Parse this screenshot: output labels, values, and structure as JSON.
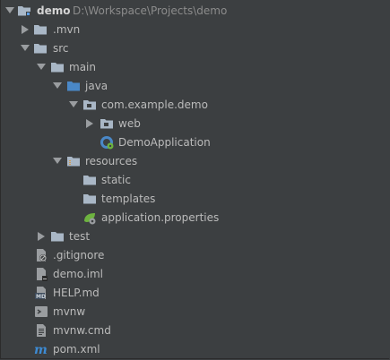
{
  "project": {
    "name": "demo",
    "path": "D:\\Workspace\\Projects\\demo"
  },
  "nodes": [
    {
      "label": "demo",
      "icon": "module-folder-icon",
      "state": "expanded"
    },
    {
      "label": ".mvn",
      "icon": "folder-icon",
      "state": "collapsed"
    },
    {
      "label": "src",
      "icon": "folder-icon",
      "state": "expanded"
    },
    {
      "label": "main",
      "icon": "folder-icon",
      "state": "expanded"
    },
    {
      "label": "java",
      "icon": "source-root-folder-icon",
      "state": "expanded"
    },
    {
      "label": "com.example.demo",
      "icon": "package-icon",
      "state": "expanded"
    },
    {
      "label": "web",
      "icon": "package-icon",
      "state": "collapsed"
    },
    {
      "label": "DemoApplication",
      "icon": "spring-boot-class-icon",
      "state": "leaf"
    },
    {
      "label": "resources",
      "icon": "resources-root-folder-icon",
      "state": "expanded"
    },
    {
      "label": "static",
      "icon": "folder-icon",
      "state": "leaf"
    },
    {
      "label": "templates",
      "icon": "folder-icon",
      "state": "leaf"
    },
    {
      "label": "application.properties",
      "icon": "spring-properties-icon",
      "state": "leaf"
    },
    {
      "label": "test",
      "icon": "folder-icon",
      "state": "collapsed"
    },
    {
      "label": ".gitignore",
      "icon": "gitignore-file-icon",
      "state": "leaf"
    },
    {
      "label": "demo.iml",
      "icon": "iml-file-icon",
      "state": "leaf"
    },
    {
      "label": "HELP.md",
      "icon": "markdown-file-icon",
      "state": "leaf"
    },
    {
      "label": "mvnw",
      "icon": "shell-script-icon",
      "state": "leaf"
    },
    {
      "label": "mvnw.cmd",
      "icon": "text-file-icon",
      "state": "leaf"
    },
    {
      "label": "pom.xml",
      "icon": "maven-pom-icon",
      "state": "leaf"
    }
  ],
  "colors": {
    "background": "#3c3f41",
    "text": "#bbbbbb",
    "path_text": "#8c8c8c",
    "folder": "#a9b7c6",
    "source_root": "#5c9ee6",
    "spring_green": "#6db33f",
    "maven_blue": "#3d8bd4"
  }
}
